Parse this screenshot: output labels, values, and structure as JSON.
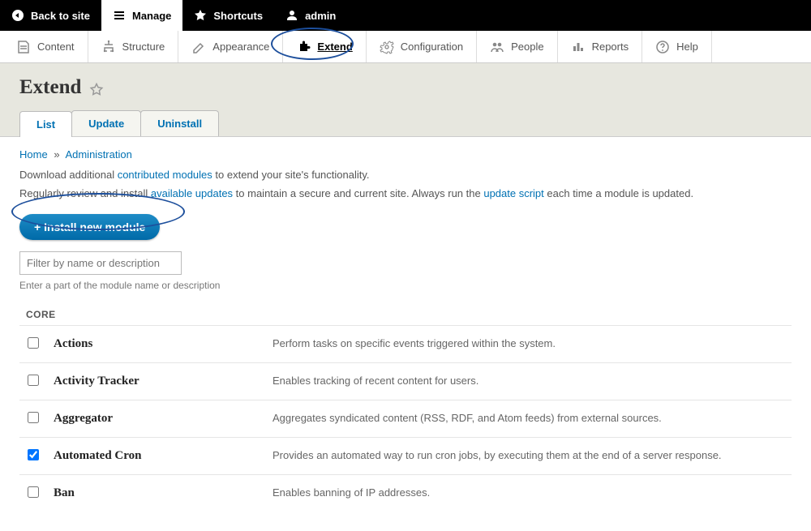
{
  "topbar": {
    "back": "Back to site",
    "manage": "Manage",
    "shortcuts": "Shortcuts",
    "user": "admin"
  },
  "adminmenu": [
    {
      "id": "content",
      "label": "Content"
    },
    {
      "id": "structure",
      "label": "Structure"
    },
    {
      "id": "appearance",
      "label": "Appearance"
    },
    {
      "id": "extend",
      "label": "Extend",
      "active": true
    },
    {
      "id": "configuration",
      "label": "Configuration"
    },
    {
      "id": "people",
      "label": "People"
    },
    {
      "id": "reports",
      "label": "Reports"
    },
    {
      "id": "help",
      "label": "Help"
    }
  ],
  "page": {
    "title": "Extend",
    "tabs": [
      {
        "id": "list",
        "label": "List",
        "active": true
      },
      {
        "id": "update",
        "label": "Update"
      },
      {
        "id": "uninstall",
        "label": "Uninstall"
      }
    ],
    "breadcrumb": {
      "home": "Home",
      "admin": "Administration"
    },
    "para1_a": "Download additional ",
    "para1_link": "contributed modules",
    "para1_b": " to extend your site's functionality.",
    "para2_a": "Regularly review and install ",
    "para2_link1": "available updates",
    "para2_b": " to maintain a secure and current site. Always run the ",
    "para2_link2": "update script",
    "para2_c": " each time a module is updated.",
    "install_btn": "+ Install new module",
    "filter_placeholder": "Filter by name or description",
    "filter_help": "Enter a part of the module name or description",
    "group": "CORE",
    "modules": [
      {
        "name": "Actions",
        "desc": "Perform tasks on specific events triggered within the system.",
        "checked": false
      },
      {
        "name": "Activity Tracker",
        "desc": "Enables tracking of recent content for users.",
        "checked": false
      },
      {
        "name": "Aggregator",
        "desc": "Aggregates syndicated content (RSS, RDF, and Atom feeds) from external sources.",
        "checked": false
      },
      {
        "name": "Automated Cron",
        "desc": "Provides an automated way to run cron jobs, by executing them at the end of a server response.",
        "checked": true
      },
      {
        "name": "Ban",
        "desc": "Enables banning of IP addresses.",
        "checked": false
      }
    ]
  }
}
